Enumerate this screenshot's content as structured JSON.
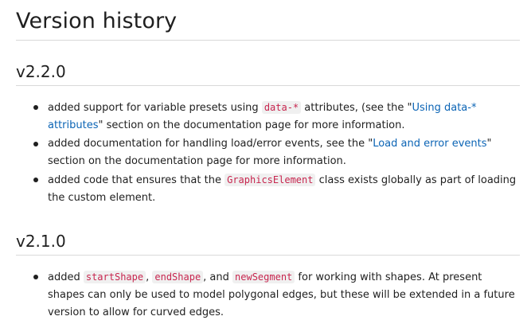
{
  "title": "Version history",
  "sections": [
    {
      "version": "v2.2.0",
      "items": [
        {
          "t1": "added support for variable presets using ",
          "code1": "data-*",
          "t2": " attributes, (see the \"",
          "link1": "Using data-* attributes",
          "t3": "\" section on the documentation page for more information."
        },
        {
          "t1": "added documentation for handling load/error events, see the \"",
          "link1": "Load and error events",
          "t2": "\" section on the documentation page for more information."
        },
        {
          "t1": "added code that ensures that the ",
          "code1": "GraphicsElement",
          "t2": " class exists globally as part of loading the custom element."
        }
      ]
    },
    {
      "version": "v2.1.0",
      "items": [
        {
          "t1": "added ",
          "code1": "startShape",
          "t2": ", ",
          "code2": "endShape",
          "t3": ", and ",
          "code3": "newSegment",
          "t4": " for working with shapes. At present shapes can only be used to model polygonal edges, but these will be extended in a future version to allow for curved edges."
        }
      ]
    }
  ]
}
